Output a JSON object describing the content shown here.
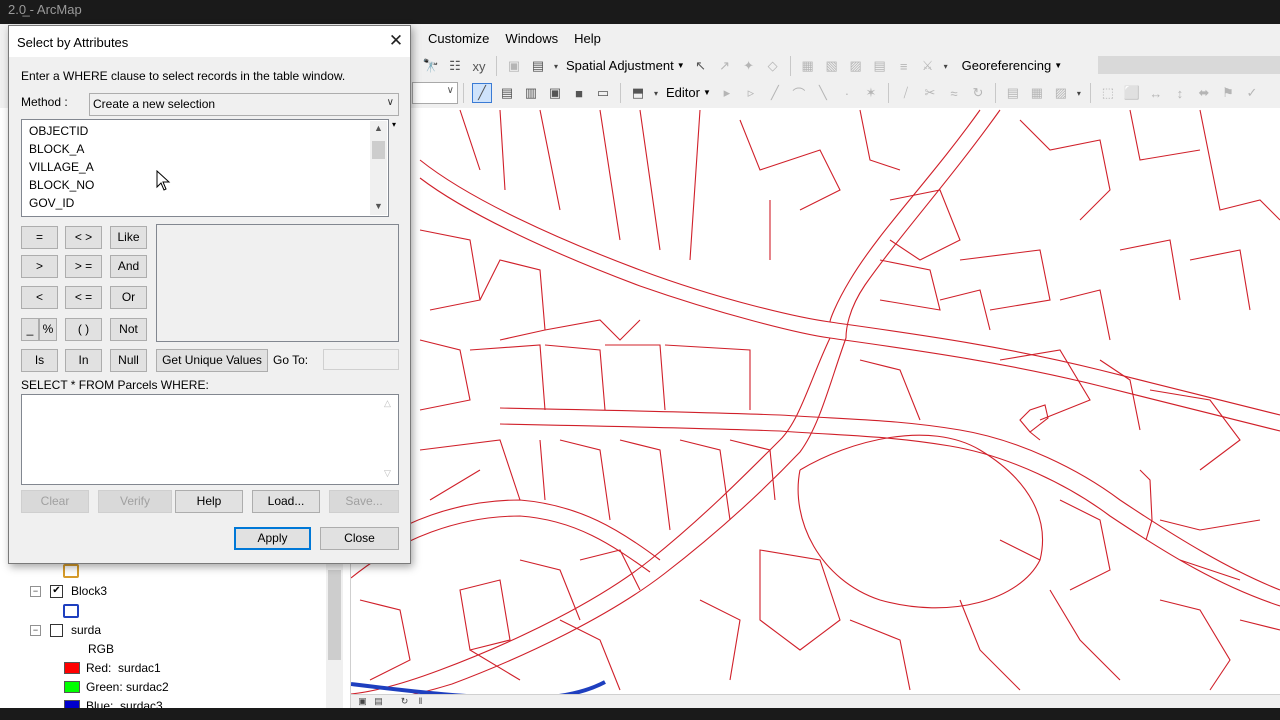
{
  "app": {
    "title": "2.0̲ - ArcMap"
  },
  "menu": {
    "customize": "Customize",
    "windows": "Windows",
    "help": "Help"
  },
  "toolbars": {
    "spatial_adjustment": "Spatial Adjustment",
    "georeferencing": "Georeferencing",
    "editor": "Editor"
  },
  "dialog": {
    "title": "Select by Attributes",
    "instruction": "Enter a WHERE clause to select records in the table window.",
    "method_label": "Method :",
    "method_value": "Create a new selection",
    "fields": [
      "OBJECTID",
      "BLOCK_A",
      "VILLAGE_A",
      "BLOCK_NO",
      "GOV_ID"
    ],
    "operators": {
      "eq": "=",
      "ne": "< >",
      "like": "Like",
      "gt": ">",
      "ge": "> =",
      "and": "And",
      "lt": "<",
      "le": "< =",
      "or": "Or",
      "underscore": "_",
      "percent": "%",
      "parens": "( )",
      "not": "Not",
      "is": "Is",
      "in": "In",
      "null": "Null"
    },
    "get_unique_values": "Get Unique Values",
    "goto_label": "Go To:",
    "select_from": "SELECT * FROM Parcels WHERE:",
    "buttons": {
      "clear": "Clear",
      "verify": "Verify",
      "help": "Help",
      "load": "Load...",
      "save": "Save...",
      "apply": "Apply",
      "close": "Close"
    }
  },
  "toc": {
    "layers": [
      {
        "name": "Block3",
        "checked": true
      },
      {
        "name": "surda",
        "checked": false
      }
    ],
    "rgb_label": "RGB",
    "bands": [
      {
        "label": "Red:",
        "band": "surdac1",
        "color": "#ff0000"
      },
      {
        "label": "Green:",
        "band": "surdac2",
        "color": "#00ff00"
      },
      {
        "label": "Blue:",
        "band": "surdac3",
        "color": "#0000cc"
      }
    ]
  },
  "colors": {
    "parcel_line": "#d0202a",
    "block_outline": "#1e3fbf",
    "block_swatch": "#d69b2a"
  }
}
